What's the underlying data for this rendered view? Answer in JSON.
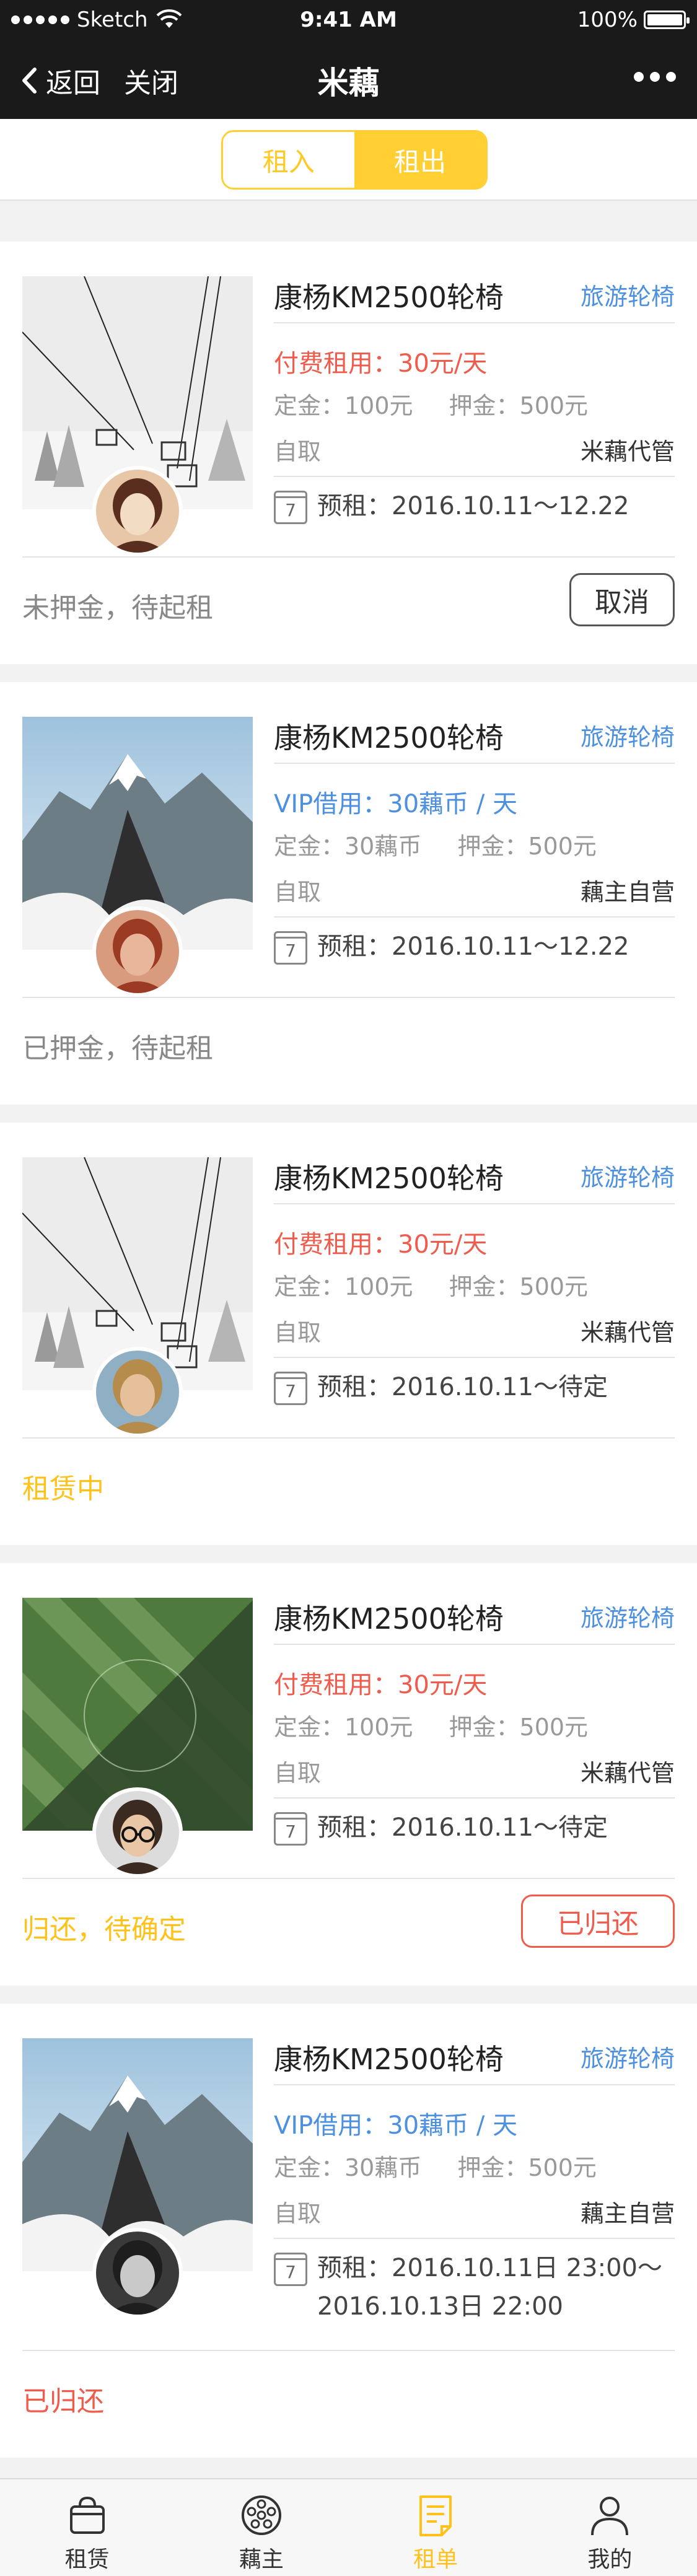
{
  "status_bar": {
    "carrier": "Sketch",
    "time": "9:41 AM",
    "battery": "100%"
  },
  "nav": {
    "back_label": "返回",
    "close_label": "关闭",
    "title": "米藕"
  },
  "segment": {
    "left": "租入",
    "right": "租出",
    "active": "租出"
  },
  "cards": [
    {
      "name": "康杨KM2500轮椅",
      "category": "旅游轮椅",
      "price": "付费租用：30元/天",
      "price_type": "pay",
      "deposit": "定金：100元",
      "guarantee": "押金：500元",
      "pickup": "自取",
      "manage": "米藕代管",
      "calendar_day": "7",
      "rent_line1": "预租：2016.10.11～12.22",
      "rent_line2": "",
      "status": "未押金，待起租",
      "status_color": "gray",
      "button": "取消",
      "photo": "ski-lift",
      "avatar": "woman-smile"
    },
    {
      "name": "康杨KM2500轮椅",
      "category": "旅游轮椅",
      "price": "VIP借用：30藕币 / 天",
      "price_type": "vip",
      "deposit": "定金：30藕币",
      "guarantee": "押金：500元",
      "pickup": "自取",
      "manage": "藕主自营",
      "calendar_day": "7",
      "rent_line1": "预租：2016.10.11～12.22",
      "rent_line2": "",
      "status": "已押金，待起租",
      "status_color": "gray",
      "button": "",
      "photo": "mountain",
      "avatar": "woman-red"
    },
    {
      "name": "康杨KM2500轮椅",
      "category": "旅游轮椅",
      "price": "付费租用：30元/天",
      "price_type": "pay",
      "deposit": "定金：100元",
      "guarantee": "押金：500元",
      "pickup": "自取",
      "manage": "米藕代管",
      "calendar_day": "7",
      "rent_line1": "预租：2016.10.11～待定",
      "rent_line2": "",
      "status": "租赁中",
      "status_color": "yellow",
      "button": "",
      "photo": "ski-lift",
      "avatar": "man-blond"
    },
    {
      "name": "康杨KM2500轮椅",
      "category": "旅游轮椅",
      "price": "付费租用：30元/天",
      "price_type": "pay",
      "deposit": "定金：100元",
      "guarantee": "押金：500元",
      "pickup": "自取",
      "manage": "米藕代管",
      "calendar_day": "7",
      "rent_line1": "预租：2016.10.11～待定",
      "rent_line2": "",
      "status": "归还，待确定",
      "status_color": "yellow",
      "button": "已归还",
      "photo": "field",
      "avatar": "man-glasses"
    },
    {
      "name": "康杨KM2500轮椅",
      "category": "旅游轮椅",
      "price": "VIP借用：30藕币 / 天",
      "price_type": "vip",
      "deposit": "定金：30藕币",
      "guarantee": "押金：500元",
      "pickup": "自取",
      "manage": "藕主自营",
      "calendar_day": "7",
      "rent_line1": "预租：2016.10.11日 23:00～",
      "rent_line2": "2016.10.13日 22:00",
      "status": "已归还",
      "status_color": "red",
      "button": "",
      "photo": "mountain",
      "avatar": "man-dark"
    }
  ],
  "tabbar": [
    {
      "label": "租赁",
      "icon": "bag-icon",
      "active": false
    },
    {
      "label": "藕主",
      "icon": "lotus-root-icon",
      "active": false
    },
    {
      "label": "租单",
      "icon": "order-list-icon",
      "active": true
    },
    {
      "label": "我的",
      "icon": "person-icon",
      "active": false
    }
  ],
  "colors": {
    "accent": "#ffcf33",
    "price_red": "#ef5b4c",
    "vip_blue": "#4d90e0",
    "nav_bg": "#1a1a1a"
  }
}
